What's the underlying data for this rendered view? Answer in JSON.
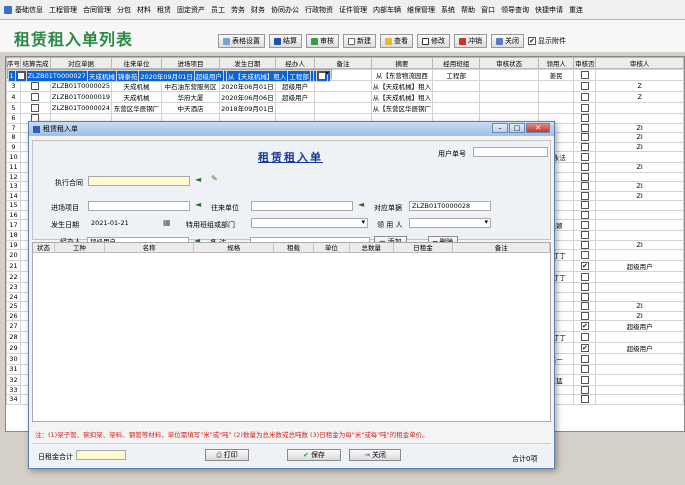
{
  "menu": [
    "基础信息",
    "工程管理",
    "合同管理",
    "分包",
    "材料",
    "租赁",
    "固定资产",
    "员工",
    "劳务",
    "财务",
    "协同办公",
    "行政物资",
    "证件管理",
    "内部车辆",
    "维保管理",
    "系统",
    "帮助",
    "窗口",
    "领导查询",
    "快捷申请",
    "重连"
  ],
  "page_title": "租赁租入单列表",
  "toolbar": {
    "buttons": [
      "表格设置",
      "结算",
      "审核",
      "新建",
      "查看",
      "修改",
      "冲销",
      "关闭"
    ],
    "show_attachment": "显示附件"
  },
  "table": {
    "headers": [
      "序号",
      "结算完成",
      "对应单据",
      "往来单位",
      "进场项目",
      "发生日期",
      "经办人",
      "备注",
      "摘要",
      "经用班组",
      "审核状态",
      "领用人",
      "审核否",
      "审核人"
    ],
    "rows": [
      [
        "1",
        "",
        "ZLZB01T0000027",
        "天成机械",
        "锦泰苑",
        "2020年09月01日",
        "超级用户",
        "",
        "从【天成机械】租入",
        "工程部",
        "",
        "",
        "",
        ""
      ],
      [
        "2",
        "",
        "ZLZB01T0000026",
        "东营物流园西城",
        "市场项目",
        "2020年08月01日",
        "超级用户",
        "",
        "从【东营物流园西",
        "工程部",
        "",
        "姜民",
        "",
        ""
      ],
      [
        "3",
        "",
        "ZLZB01T0000025",
        "天成机械",
        "中石油东营服务区",
        "2020年06月01日",
        "超级用户",
        "",
        "从【天成机械】租入",
        "",
        "",
        "",
        "",
        "Z"
      ],
      [
        "4",
        "",
        "ZLZB01T0000019",
        "天成机械",
        "华府大厦",
        "2020年06月06日",
        "超级用户",
        "",
        "从【天成机械】租入",
        "",
        "",
        "",
        "",
        "Z"
      ],
      [
        "5",
        "",
        "ZLZB01T0000024",
        "东营区华辰钢厂",
        "中天酒店",
        "2018年09月01日",
        "",
        "",
        "从【东营区华辰钢厂",
        "",
        "",
        "",
        "",
        ""
      ],
      [
        "6",
        "",
        "",
        "",
        "",
        "",
        "",
        "",
        "",
        "",
        "",
        "",
        "",
        ""
      ],
      [
        "7",
        "",
        "",
        "",
        "",
        "",
        "",
        "",
        "",
        "",
        "",
        "",
        "",
        "ZI"
      ],
      [
        "8",
        "",
        "",
        "",
        "",
        "",
        "",
        "",
        "",
        "",
        "",
        "",
        "",
        "ZI"
      ],
      [
        "9",
        "",
        "",
        "",
        "",
        "",
        "",
        "",
        "",
        "",
        "",
        "",
        "",
        "ZI"
      ],
      [
        "10",
        "",
        "",
        "",
        "",
        "",
        "",
        "",
        "",
        "",
        "",
        "马永法",
        "",
        ""
      ],
      [
        "11",
        "",
        "",
        "",
        "",
        "",
        "",
        "",
        "",
        "",
        "",
        "",
        "",
        "ZI"
      ],
      [
        "12",
        "",
        "",
        "",
        "",
        "",
        "",
        "",
        "",
        "",
        "",
        "",
        "",
        ""
      ],
      [
        "13",
        "",
        "",
        "",
        "",
        "",
        "",
        "",
        "",
        "",
        "",
        "",
        "",
        "ZI"
      ],
      [
        "14",
        "",
        "",
        "",
        "",
        "",
        "",
        "",
        "",
        "",
        "",
        "",
        "",
        "ZI"
      ],
      [
        "15",
        "",
        "",
        "",
        "",
        "",
        "",
        "",
        "",
        "",
        "",
        "",
        "",
        ""
      ],
      [
        "16",
        "",
        "",
        "",
        "",
        "",
        "",
        "",
        "",
        "",
        "",
        "",
        "",
        ""
      ],
      [
        "17",
        "",
        "",
        "",
        "",
        "",
        "",
        "",
        "",
        "",
        "",
        "吴颖",
        "",
        ""
      ],
      [
        "18",
        "",
        "",
        "",
        "",
        "",
        "",
        "",
        "",
        "",
        "",
        "",
        "",
        ""
      ],
      [
        "19",
        "",
        "",
        "",
        "",
        "",
        "",
        "",
        "",
        "",
        "",
        "",
        "",
        "ZI"
      ],
      [
        "20",
        "",
        "",
        "",
        "",
        "",
        "",
        "",
        "",
        "",
        "",
        "张丁丁",
        "",
        ""
      ],
      [
        "21",
        "",
        "",
        "",
        "",
        "",
        "",
        "",
        "",
        "",
        "",
        "",
        "✔",
        "超级用户"
      ],
      [
        "22",
        "",
        "",
        "",
        "",
        "",
        "",
        "",
        "",
        "",
        "",
        "张丁丁",
        "",
        ""
      ],
      [
        "23",
        "",
        "",
        "",
        "",
        "",
        "",
        "",
        "",
        "",
        "",
        "",
        "",
        ""
      ],
      [
        "24",
        "",
        "",
        "",
        "",
        "",
        "",
        "",
        "",
        "",
        "",
        "",
        "",
        ""
      ],
      [
        "25",
        "",
        "",
        "",
        "",
        "",
        "",
        "",
        "",
        "",
        "",
        "",
        "",
        "ZI"
      ],
      [
        "26",
        "",
        "",
        "",
        "",
        "",
        "",
        "",
        "",
        "",
        "",
        "",
        "",
        "ZI"
      ],
      [
        "27",
        "",
        "",
        "",
        "",
        "",
        "",
        "",
        "",
        "",
        "",
        "",
        "✔",
        "超级用户"
      ],
      [
        "28",
        "",
        "",
        "",
        "",
        "",
        "",
        "",
        "",
        "",
        "",
        "张丁丁",
        "",
        ""
      ],
      [
        "29",
        "",
        "",
        "",
        "",
        "",
        "",
        "",
        "",
        "",
        "",
        "",
        "✔",
        "超级用户"
      ],
      [
        "30",
        "",
        "",
        "",
        "",
        "",
        "",
        "",
        "",
        "",
        "",
        "赵一",
        "",
        ""
      ],
      [
        "31",
        "",
        "",
        "",
        "",
        "",
        "",
        "",
        "",
        "",
        "",
        "",
        "",
        ""
      ],
      [
        "32",
        "",
        "",
        "",
        "",
        "",
        "",
        "",
        "",
        "",
        "",
        "王猛",
        "",
        ""
      ],
      [
        "33",
        "",
        "",
        "",
        "",
        "",
        "",
        "",
        "",
        "",
        "",
        "",
        "",
        ""
      ],
      [
        "34",
        "",
        "",
        "",
        "",
        "",
        "",
        "",
        "",
        "",
        "",
        "",
        "",
        ""
      ]
    ]
  },
  "dialog": {
    "window_title": "租赁租入单",
    "form_title": "租赁租入单",
    "user_no_label": "用户单号",
    "contract_label": "执行合同",
    "project_label": "进场项目",
    "partner_label": "往来单位",
    "doc_label": "对应单据",
    "doc_value": "ZLZB01T0000028",
    "date_label": "发生日期",
    "date_value": "2021-01-21",
    "dept_label": "特用班组或部门",
    "receiver_label": "领 用 人",
    "handler_label": "经办人",
    "handler_value": "超级用户",
    "remark_label": "备   注",
    "add_button": "添加",
    "delete_button": "删除",
    "grid_headers": [
      "状态",
      "工种",
      "名称",
      "规格",
      "租载",
      "单位",
      "总数量",
      "日租金",
      "备注"
    ],
    "note": "注：(1)架子管、碗扣架、架料、钢管等材料，单位需填写\"米\"或\"吨\"  (2)数量为总米数或总吨数  (3)日租金为每\"米\"或每\"吨\"的租金单价。",
    "daily_total_label": "日租金合计",
    "print_button": "打印",
    "save_button": "保存",
    "close_button": "关闭",
    "total_count": "合计0项"
  },
  "colors": {
    "title_green": "#2b8a43",
    "selection_blue": "#0a64d6",
    "note_red": "#d8231f",
    "form_title_blue": "#1a3a99"
  }
}
